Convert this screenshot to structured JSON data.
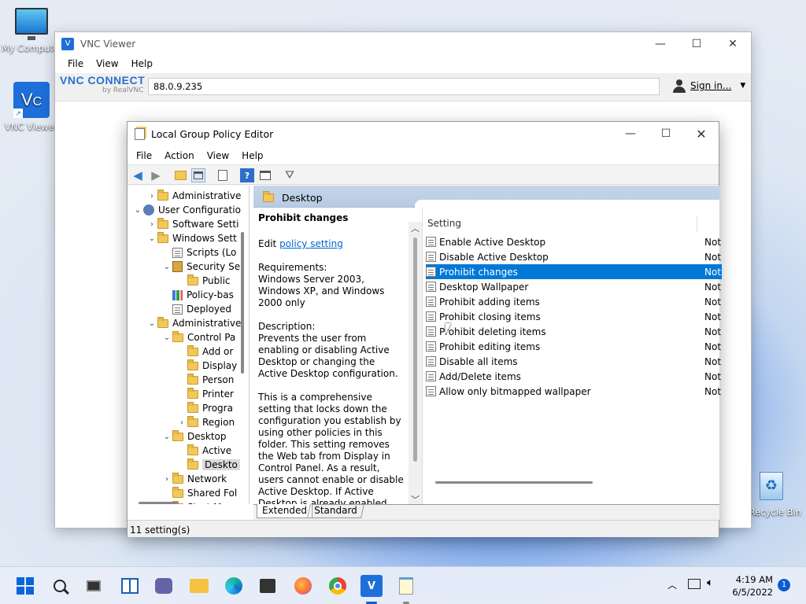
{
  "desktop": {
    "icons": [
      {
        "label": "My Computer"
      },
      {
        "label": "VNC Viewer"
      },
      {
        "label": "Recycle Bin"
      }
    ]
  },
  "vnc": {
    "title": "VNC Viewer",
    "menu": [
      "File",
      "View",
      "Help"
    ],
    "logo_main": "VNC CONNECT",
    "logo_sub": "by RealVNC",
    "address": "88.0.9.235",
    "sign_in": "Sign in..."
  },
  "gpe": {
    "title": "Local Group Policy Editor",
    "menu": [
      "File",
      "Action",
      "View",
      "Help"
    ],
    "tree": [
      {
        "label": "Administrative",
        "indent": 1,
        "arrow": "›",
        "icon": "folder"
      },
      {
        "label": "User Configuratio",
        "indent": 0,
        "arrow": "⌄",
        "icon": "user"
      },
      {
        "label": "Software Setti",
        "indent": 1,
        "arrow": "›",
        "icon": "folder"
      },
      {
        "label": "Windows Sett",
        "indent": 1,
        "arrow": "⌄",
        "icon": "folder"
      },
      {
        "label": "Scripts (Lo",
        "indent": 2,
        "arrow": "",
        "icon": "policy"
      },
      {
        "label": "Security Se",
        "indent": 2,
        "arrow": "⌄",
        "icon": "security"
      },
      {
        "label": "Public",
        "indent": 3,
        "arrow": "",
        "icon": "folder"
      },
      {
        "label": "Policy-bas",
        "indent": 2,
        "arrow": "",
        "icon": "chart"
      },
      {
        "label": "Deployed",
        "indent": 2,
        "arrow": "",
        "icon": "policy"
      },
      {
        "label": "Administrative",
        "indent": 1,
        "arrow": "⌄",
        "icon": "folder"
      },
      {
        "label": "Control Pa",
        "indent": 2,
        "arrow": "⌄",
        "icon": "folder"
      },
      {
        "label": "Add or",
        "indent": 3,
        "arrow": "",
        "icon": "folder"
      },
      {
        "label": "Display",
        "indent": 3,
        "arrow": "",
        "icon": "folder"
      },
      {
        "label": "Person",
        "indent": 3,
        "arrow": "",
        "icon": "folder"
      },
      {
        "label": "Printer",
        "indent": 3,
        "arrow": "",
        "icon": "folder"
      },
      {
        "label": "Progra",
        "indent": 3,
        "arrow": "",
        "icon": "folder"
      },
      {
        "label": "Region",
        "indent": 3,
        "arrow": "›",
        "icon": "folder"
      },
      {
        "label": "Desktop",
        "indent": 2,
        "arrow": "⌄",
        "icon": "folder"
      },
      {
        "label": "Active",
        "indent": 3,
        "arrow": "",
        "icon": "folder"
      },
      {
        "label": "Deskto",
        "indent": 3,
        "arrow": "",
        "icon": "folder",
        "selected": true
      },
      {
        "label": "Network",
        "indent": 2,
        "arrow": "›",
        "icon": "folder"
      },
      {
        "label": "Shared Fol",
        "indent": 2,
        "arrow": "",
        "icon": "folder"
      },
      {
        "label": "Start M",
        "indent": 2,
        "arrow": "",
        "icon": "folder"
      }
    ],
    "folder_header": "Desktop",
    "desc": {
      "title": "Prohibit changes",
      "edit_prefix": "Edit ",
      "edit_link": "policy setting ",
      "req_label": "Requirements:",
      "req_text": "Windows Server 2003, Windows XP, and Windows 2000 only",
      "desc_label": "Description:",
      "desc_text": "Prevents the user from enabling or disabling Active Desktop or changing the Active Desktop configuration.",
      "desc_more": "This is a comprehensive setting that locks down the configuration you establish by using other policies in this folder. This setting removes the Web tab from Display in Control Panel. As a result, users cannot enable or disable Active Desktop. If Active Desktop is already enabled, users cannot add, remove, or edit Web content or disable, lock, or synchronize"
    },
    "list_header": "Setting",
    "settings": [
      {
        "name": "Enable Active Desktop",
        "state": "Not"
      },
      {
        "name": "Disable Active Desktop",
        "state": "Not"
      },
      {
        "name": "Prohibit changes",
        "state": "Not",
        "selected": true
      },
      {
        "name": "Desktop Wallpaper",
        "state": "Not"
      },
      {
        "name": "Prohibit adding items",
        "state": "Not"
      },
      {
        "name": "Prohibit closing items",
        "state": "Not"
      },
      {
        "name": "Prohibit deleting items",
        "state": "Not"
      },
      {
        "name": "Prohibit editing items",
        "state": "Not"
      },
      {
        "name": "Disable all items",
        "state": "Not"
      },
      {
        "name": "Add/Delete items",
        "state": "Not"
      },
      {
        "name": "Allow only bitmapped wallpaper",
        "state": "Not"
      }
    ],
    "tabs": [
      "Extended",
      "Standard"
    ],
    "status": "11 setting(s)"
  },
  "taskbar": {
    "time": "4:19 AM",
    "date": "6/5/2022",
    "notif_count": "1"
  },
  "colors": {
    "selection": "#0078d7",
    "link": "#0066cc",
    "accent": "#0b5bd3"
  }
}
